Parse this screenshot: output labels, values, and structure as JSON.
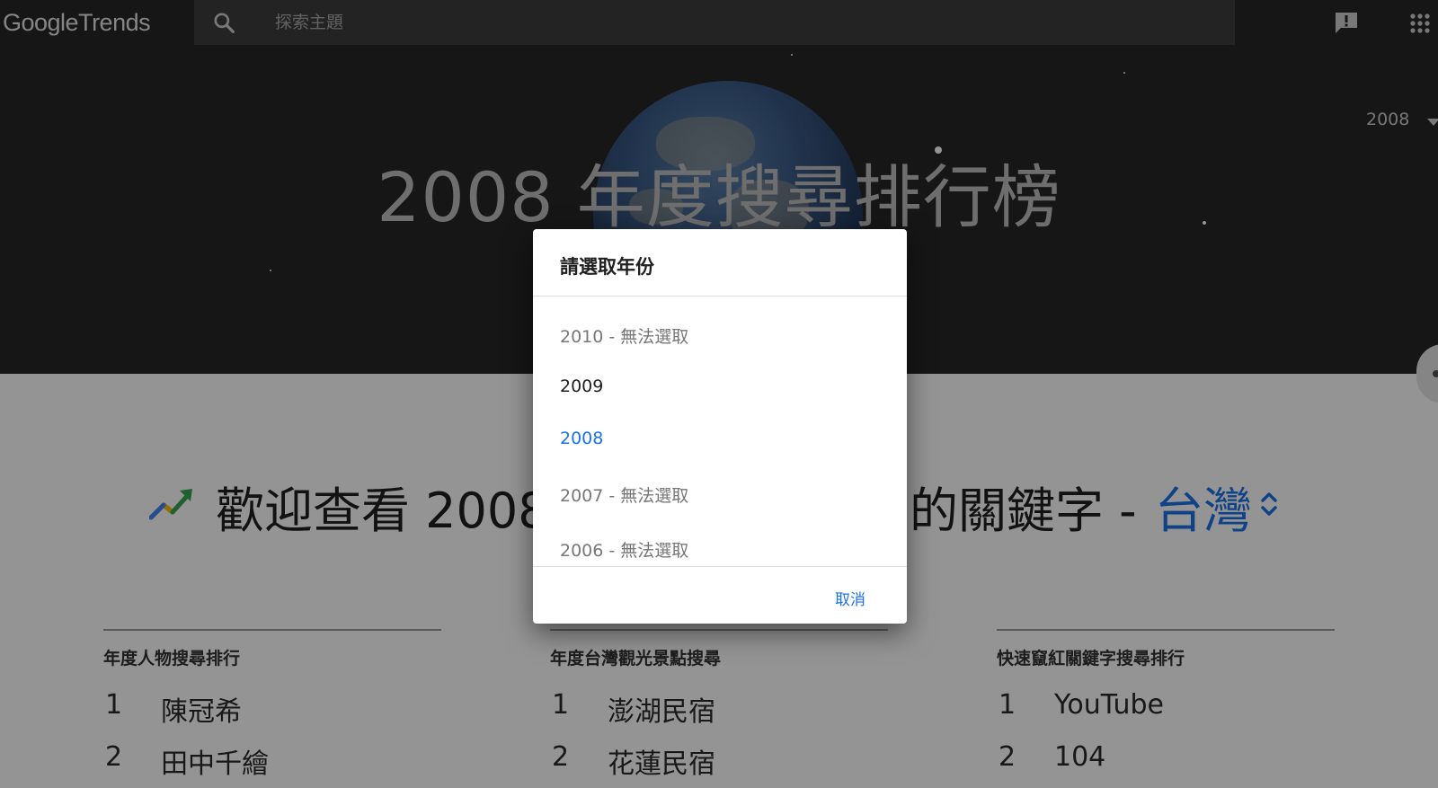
{
  "header": {
    "logo_google": "Google",
    "logo_trends": "Trends",
    "search_placeholder": "探索主題"
  },
  "hero": {
    "title": "2008 年度搜尋排行榜",
    "year_selected": "2008"
  },
  "welcome": {
    "text_start": "歡迎查看 2008",
    "text_end": "的關鍵字 - ",
    "region": "台灣"
  },
  "columns": [
    {
      "title": "年度人物搜尋排行",
      "items": [
        {
          "rank": "1",
          "name": "陳冠希"
        },
        {
          "rank": "2",
          "name": "田中千繪"
        }
      ]
    },
    {
      "title": "年度台灣觀光景點搜尋",
      "items": [
        {
          "rank": "1",
          "name": "澎湖民宿"
        },
        {
          "rank": "2",
          "name": "花蓮民宿"
        }
      ]
    },
    {
      "title": "快速竄紅關鍵字搜尋排行",
      "items": [
        {
          "rank": "1",
          "name": "YouTube"
        },
        {
          "rank": "2",
          "name": "104"
        }
      ]
    }
  ],
  "dialog": {
    "title": "請選取年份",
    "options": [
      {
        "label": "2010 - 無法選取",
        "state": "disabled"
      },
      {
        "label": "2009",
        "state": "normal"
      },
      {
        "label": "2008",
        "state": "selected"
      },
      {
        "label": "2007 - 無法選取",
        "state": "disabled"
      },
      {
        "label": "2006 - 無法選取",
        "state": "disabled"
      }
    ],
    "cancel_label": "取消"
  },
  "colors": {
    "accent": "#1a73e8",
    "hero_bg": "#262626"
  }
}
